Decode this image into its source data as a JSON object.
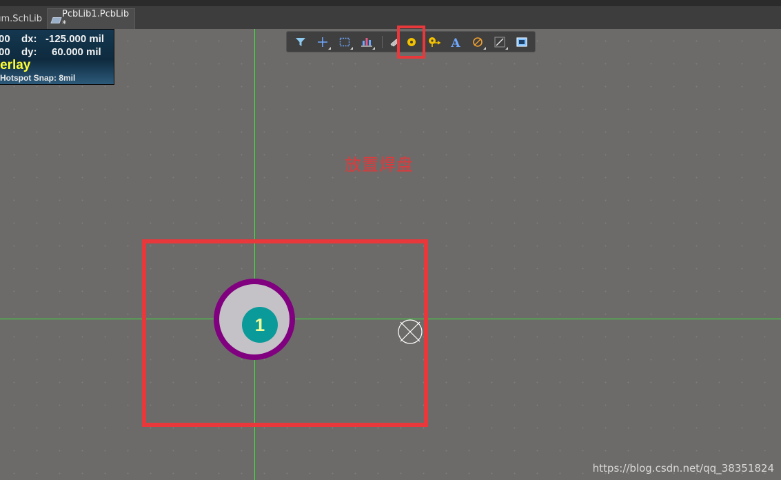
{
  "tabs": [
    {
      "label": "um.SchLib",
      "active": false
    },
    {
      "label": "PcbLib1.PcbLib *",
      "active": true
    }
  ],
  "hud": {
    "x_value": "00",
    "dx_label": "dx:",
    "dx_value": "-125.000 mil",
    "y_value": "00",
    "dy_label": "dy:",
    "dy_value": "60.000  mil",
    "layer": "erlay",
    "snap": "Hotspot Snap: 8mil"
  },
  "toolbar": {
    "tools": [
      {
        "name": "filter",
        "icon": "filter-icon",
        "dropdown": false
      },
      {
        "name": "cross",
        "icon": "cross-icon",
        "dropdown": true
      },
      {
        "name": "select",
        "icon": "select-rect-icon",
        "dropdown": true
      },
      {
        "name": "align",
        "icon": "align-icon",
        "dropdown": true
      },
      {
        "name": "component",
        "icon": "component-icon",
        "dropdown": false
      },
      {
        "name": "place-pad",
        "icon": "pad-icon",
        "dropdown": false
      },
      {
        "name": "place-via",
        "icon": "via-icon",
        "dropdown": false
      },
      {
        "name": "place-text",
        "icon": "text-icon",
        "dropdown": false
      },
      {
        "name": "arc",
        "icon": "arc-icon",
        "dropdown": true
      },
      {
        "name": "line",
        "icon": "line-icon",
        "dropdown": true
      },
      {
        "name": "region",
        "icon": "region-icon",
        "dropdown": false
      }
    ],
    "text_tool_glyph": "A"
  },
  "annotation": "放置焊盘",
  "pad": {
    "designator": "1"
  },
  "watermark": "https://blog.csdn.net/qq_38351824",
  "colors": {
    "canvas": "#6d6b69",
    "highlight": "#e8383b",
    "crosshair": "#38e838",
    "pad_outer": "#800080",
    "pad_ring": "#c4c2c6",
    "pad_hole": "#0b9a9a"
  }
}
